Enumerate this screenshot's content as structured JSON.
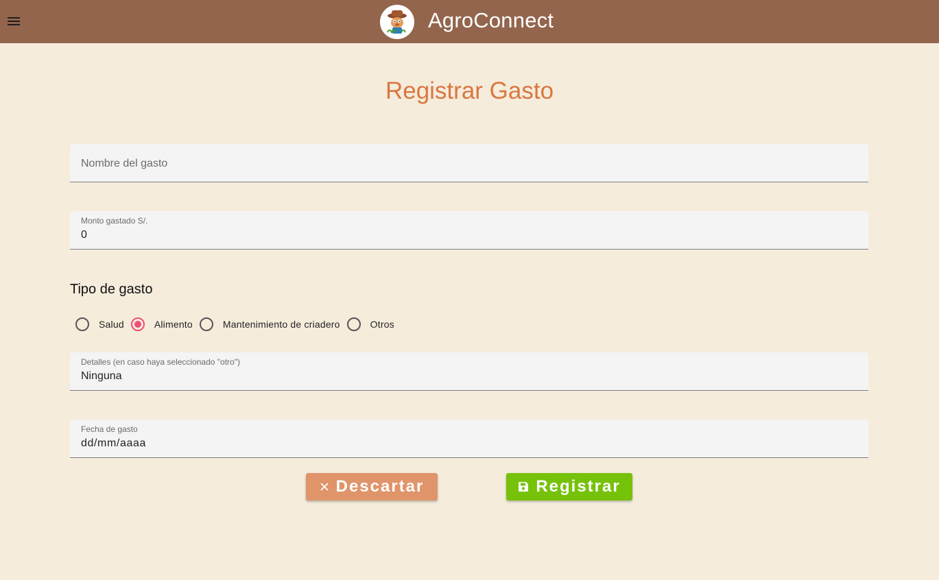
{
  "header": {
    "app_title": "AgroConnect",
    "menu_icon": "hamburger-menu-icon",
    "logo_icon": "farmer-mascot-logo",
    "background_color": "#93654d"
  },
  "page": {
    "title": "Registrar Gasto",
    "title_color": "#d9773f",
    "background_color": "#f5ecdc"
  },
  "form": {
    "expense_name": {
      "placeholder": "Nombre del gasto",
      "value": ""
    },
    "amount": {
      "label": "Monto gastado S/.",
      "value": "0"
    },
    "expense_type": {
      "label": "Tipo de gasto",
      "options": [
        "Salud",
        "Alimento",
        "Mantenimiento de criadero",
        "Otros"
      ],
      "selected": "Alimento",
      "accent_color": "#ef4d78"
    },
    "details": {
      "label": "Detalles (en caso haya seleccionado \"otro\")",
      "value": "Ninguna"
    },
    "date": {
      "label": "Fecha de gasto",
      "value": "dd/mm/aaaa"
    }
  },
  "actions": {
    "discard": {
      "label": "Descartar",
      "icon": "close-icon",
      "color": "#e0946a"
    },
    "register": {
      "label": "Registrar",
      "icon": "save-icon",
      "color": "#76c20b"
    }
  }
}
